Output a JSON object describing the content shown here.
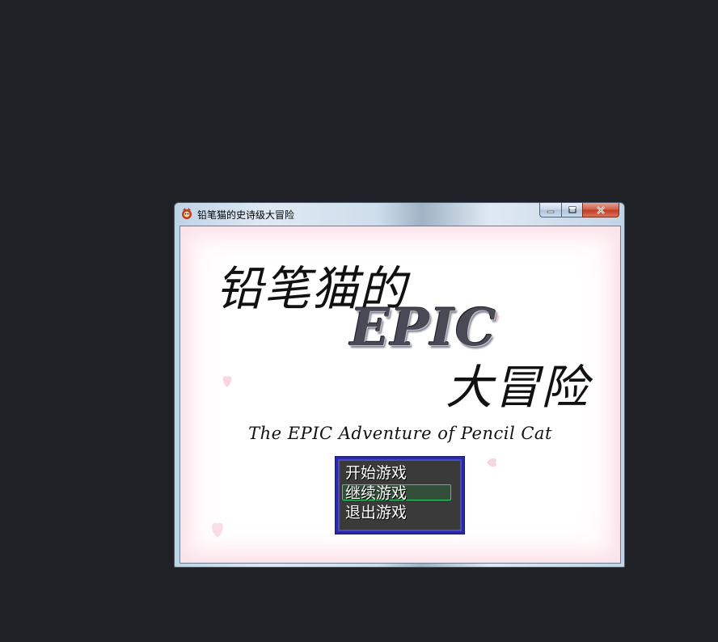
{
  "window": {
    "title": "铅笔猫的史诗级大冒险",
    "icon": "app-icon",
    "buttons": [
      "minimize-icon",
      "maximize-icon",
      "close-icon"
    ]
  },
  "game": {
    "title_line1": "铅笔猫的",
    "title_line2": "EPIC",
    "title_line3": "大冒险",
    "subtitle": "The EPIC Adventure of Pencil Cat"
  },
  "menu": {
    "items": [
      {
        "label": "开始游戏"
      },
      {
        "label": "继续游戏"
      },
      {
        "label": "退出游戏"
      }
    ],
    "selected_index": 1
  },
  "colors": {
    "desktop": "#1f2126",
    "menu_bg": "#3a3a3a",
    "menu_border": "#2a2aa8",
    "selection": "#2ed36a"
  }
}
